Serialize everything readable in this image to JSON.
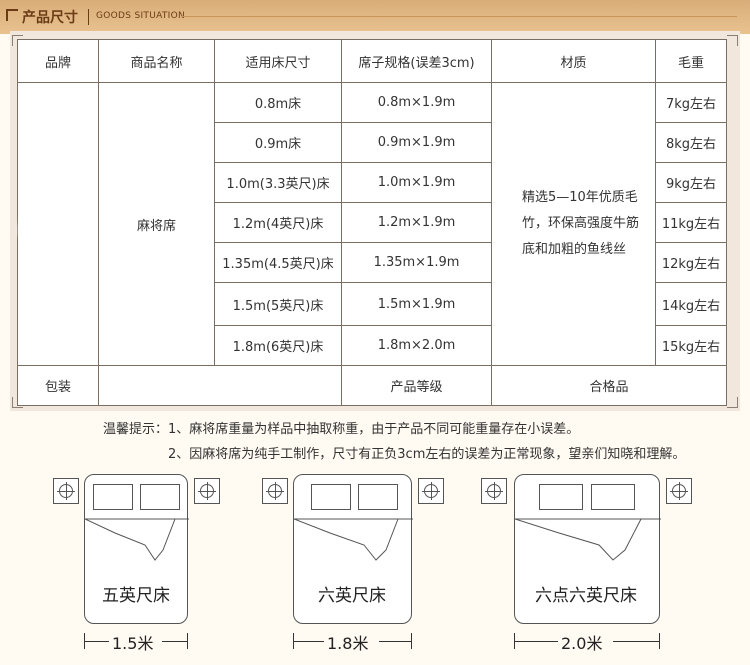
{
  "banner": {
    "title": "产品尺寸",
    "subtitle": "GOODS SITUATION"
  },
  "table": {
    "headers": [
      "品牌",
      "商品名称",
      "适用床尺寸",
      "席子规格(误差3cm)",
      "材质",
      "毛重"
    ],
    "product_name": "麻将席",
    "material": [
      "精选5—10年优质毛",
      "竹，环保高强度牛筋",
      "底和加粗的鱼线丝"
    ],
    "rows": [
      {
        "bed": "0.8m床",
        "spec": "0.8m×1.9m",
        "weight": "7kg左右"
      },
      {
        "bed": "0.9m床",
        "spec": "0.9m×1.9m",
        "weight": "8kg左右"
      },
      {
        "bed": "1.0m(3.3英尺)床",
        "spec": "1.0m×1.9m",
        "weight": "9kg左右"
      },
      {
        "bed": "1.2m(4英尺)床",
        "spec": "1.2m×1.9m",
        "weight": "11kg左右"
      },
      {
        "bed": "1.35m(4.5英尺)床",
        "spec": "1.35m×1.9m",
        "weight": "12kg左右"
      },
      {
        "bed": "1.5m(5英尺)床",
        "spec": "1.5m×1.9m",
        "weight": "14kg左右"
      },
      {
        "bed": "1.8m(6英尺)床",
        "spec": "1.8m×2.0m",
        "weight": "15kg左右"
      }
    ],
    "footer": {
      "packaging": "包装",
      "grade_label": "产品等级",
      "grade_value": "合格品"
    }
  },
  "notes": {
    "line1": "温馨提示：1、麻将席重量为样品中抽取称重，由于产品不同可能重量存在小误差。",
    "line2": "2、因麻将席为纯手工制作，尺寸有正负3cm左右的误差为正常现象，望亲们知晓和理解。"
  },
  "beds": [
    {
      "label": "五英尺床",
      "width": "1.5米"
    },
    {
      "label": "六英尺床",
      "width": "1.8米"
    },
    {
      "label": "六点六英尺床",
      "width": "2.0米"
    }
  ]
}
